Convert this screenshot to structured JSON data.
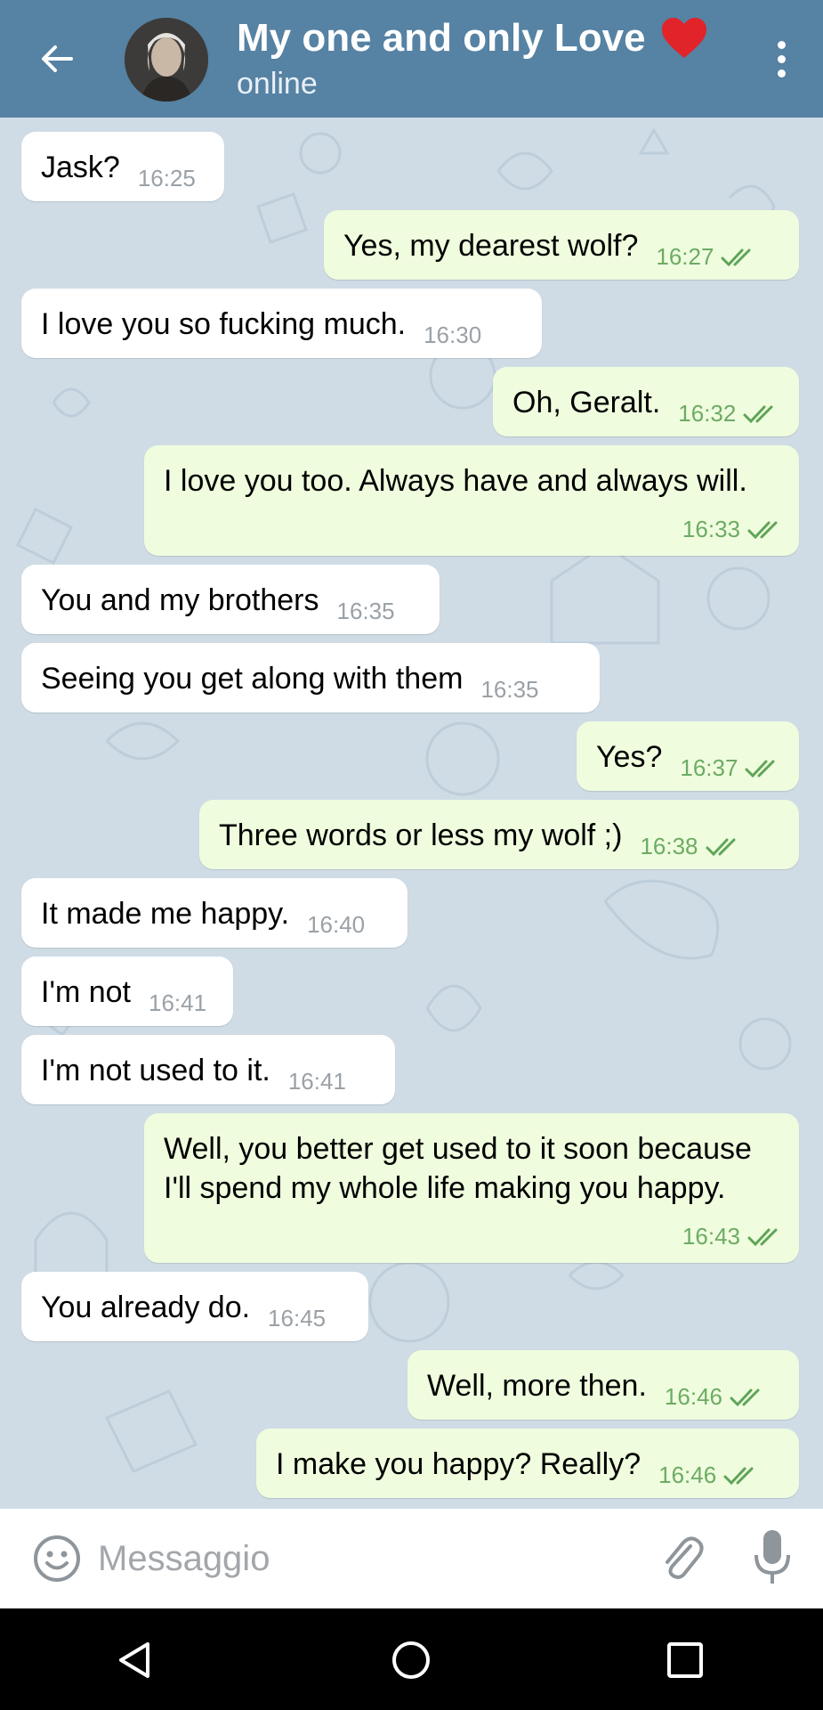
{
  "header": {
    "title": "My one and only Love",
    "status": "online",
    "heart_color": "#e0242a",
    "back_icon": "arrow-left-icon",
    "menu_icon": "more-vertical-icon"
  },
  "colors": {
    "header_bg": "#5682a3",
    "chat_bg": "#cfdce6",
    "incoming_bubble": "#ffffff",
    "outgoing_bubble": "#effdde",
    "outgoing_time": "#6dab64"
  },
  "messages": [
    {
      "dir": "in",
      "text": "Jask?",
      "time": "16:25"
    },
    {
      "dir": "out",
      "text": "Yes, my dearest wolf?",
      "time": "16:27",
      "read": true
    },
    {
      "dir": "in",
      "text": "I love you so fucking much.",
      "time": "16:30"
    },
    {
      "dir": "out",
      "text": "Oh, Geralt.",
      "time": "16:32",
      "read": true
    },
    {
      "dir": "out",
      "text": "I love you too. Always have and always will.",
      "time": "16:33",
      "read": true
    },
    {
      "dir": "in",
      "text": "You and my brothers",
      "time": "16:35"
    },
    {
      "dir": "in",
      "text": "Seeing you get along with them",
      "time": "16:35"
    },
    {
      "dir": "out",
      "text": "Yes?",
      "time": "16:37",
      "read": true
    },
    {
      "dir": "out",
      "text": "Three words or less my wolf ;)",
      "time": "16:38",
      "read": true
    },
    {
      "dir": "in",
      "text": "It made me happy.",
      "time": "16:40"
    },
    {
      "dir": "in",
      "text": "I'm not",
      "time": "16:41"
    },
    {
      "dir": "in",
      "text": "I'm not used to it.",
      "time": "16:41"
    },
    {
      "dir": "out",
      "text": "Well, you better get used to it soon because I'll spend my whole life making you happy.",
      "time": "16:43",
      "read": true
    },
    {
      "dir": "in",
      "text": "You already do.",
      "time": "16:45"
    },
    {
      "dir": "out",
      "text": "Well, more then.",
      "time": "16:46",
      "read": true
    },
    {
      "dir": "out",
      "text": "I make you happy? Really?",
      "time": "16:46",
      "read": true
    }
  ],
  "composer": {
    "placeholder": "Messaggio",
    "emoji_icon": "smiley-icon",
    "attach_icon": "paperclip-icon",
    "mic_icon": "microphone-icon"
  },
  "system_nav": {
    "back_icon": "triangle-back-icon",
    "home_icon": "circle-home-icon",
    "recent_icon": "square-recents-icon"
  }
}
